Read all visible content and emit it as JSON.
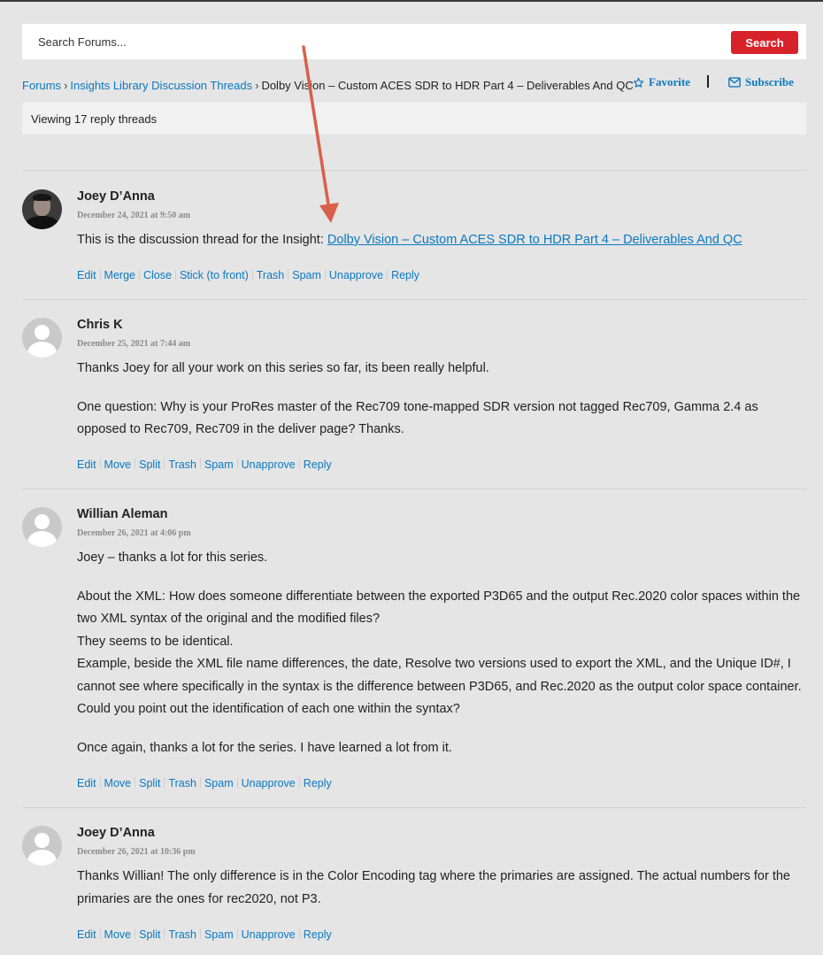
{
  "search": {
    "placeholder": "Search Forums...",
    "button_label": "Search"
  },
  "breadcrumb": {
    "items": [
      "Forums",
      "Insights Library Discussion Threads"
    ],
    "current": "Dolby Vision – Custom ACES SDR to HDR Part 4 – Deliverables And QC",
    "separator": "›"
  },
  "topic_actions": {
    "favorite_label": "Favorite",
    "subscribe_label": "Subscribe"
  },
  "viewing_text": "Viewing 17 reply threads",
  "posts": [
    {
      "author": "Joey D’Anna",
      "date": "December 24, 2021 at 9:50 am",
      "text_prefix": "This is the discussion thread for the Insight: ",
      "link_text": "Dolby Vision – Custom ACES SDR to HDR Part 4 – Deliverables And QC",
      "actions": [
        "Edit",
        "Merge",
        "Close",
        "Stick (to front)",
        "Trash",
        "Spam",
        "Unapprove",
        "Reply"
      ]
    },
    {
      "author": "Chris K",
      "date": "December 25, 2021 at 7:44 am",
      "paragraphs": [
        "Thanks Joey for all your work on this series so far, its been really helpful.",
        "One question: Why is your ProRes master of the Rec709 tone-mapped SDR version not tagged Rec709, Gamma 2.4 as opposed to Rec709, Rec709 in the deliver page? Thanks."
      ],
      "actions": [
        "Edit",
        "Move",
        "Split",
        "Trash",
        "Spam",
        "Unapprove",
        "Reply"
      ]
    },
    {
      "author": "Willian Aleman",
      "date": "December 26, 2021 at 4:06 pm",
      "paragraphs": [
        "Joey – thanks a lot for this series.",
        "About the XML: How does someone differentiate between the exported P3D65 and the output Rec.2020 color spaces within the two XML syntax of the original and the modified files?\nThey seems to be identical.\nExample, beside the XML file name differences, the date, Resolve two versions used to export the XML, and the Unique ID#, I cannot see where specifically in the syntax is the difference between P3D65, and Rec.2020 as the output color space container. Could you point out the identification of each one within the syntax?",
        "Once again, thanks a lot for the series. I have learned a lot from it."
      ],
      "actions": [
        "Edit",
        "Move",
        "Split",
        "Trash",
        "Spam",
        "Unapprove",
        "Reply"
      ]
    },
    {
      "author": "Joey D’Anna",
      "date": "December 26, 2021 at 10:36 pm",
      "paragraphs": [
        "Thanks Willian! The only difference is in the Color Encoding tag where the primaries are assigned. The actual numbers for the primaries are the ones for rec2020, not P3."
      ],
      "actions": [
        "Edit",
        "Move",
        "Split",
        "Trash",
        "Spam",
        "Unapprove",
        "Reply"
      ]
    }
  ],
  "colors": {
    "link": "#0b79c0",
    "search_button": "#d8222a",
    "annotation_arrow": "#d9604a",
    "background": "#e5e5e5"
  },
  "icons": {
    "favorite": "star-outline-icon",
    "subscribe": "envelope-icon",
    "avatar_default": "default-user-avatar-icon"
  }
}
